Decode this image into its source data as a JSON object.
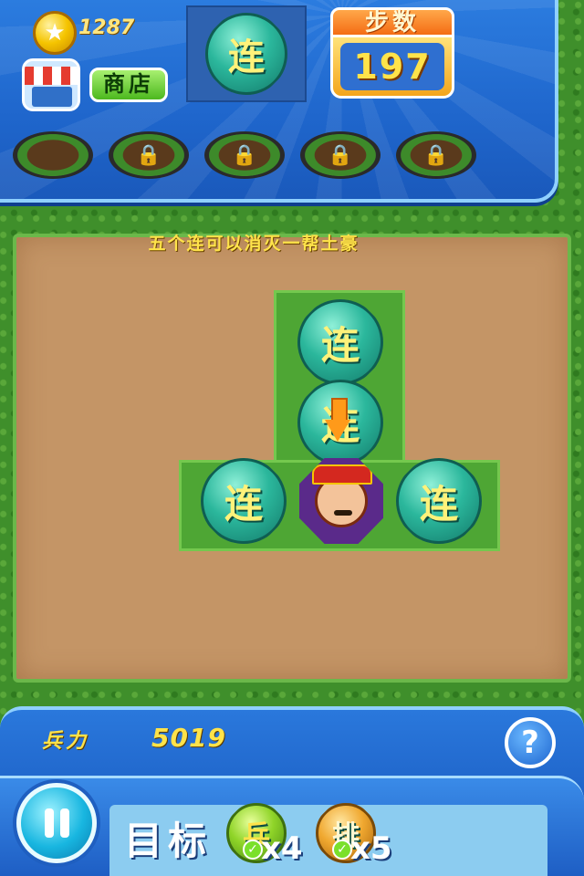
{
  "hud": {
    "coins": "1287",
    "shop_label": "商店",
    "target_gem": "连",
    "steps_title": "步数",
    "steps_count": "197"
  },
  "hint_text": "五个连可以消灭一帮土豪",
  "board": {
    "gems": [
      "连",
      "连",
      "连",
      "连"
    ]
  },
  "bottom": {
    "power_label": "兵力",
    "power_value": "5019",
    "help": "?",
    "goal_label": "目标",
    "goals": [
      {
        "glyph": "兵",
        "count": "x4",
        "color": "#8fd428"
      },
      {
        "glyph": "排",
        "count": "x5",
        "color": "#f0a830"
      }
    ]
  },
  "icons": [
    "coin-icon",
    "shop-icon",
    "lock-icon",
    "arrow-down-icon",
    "help-icon",
    "pause-icon",
    "check-icon"
  ]
}
